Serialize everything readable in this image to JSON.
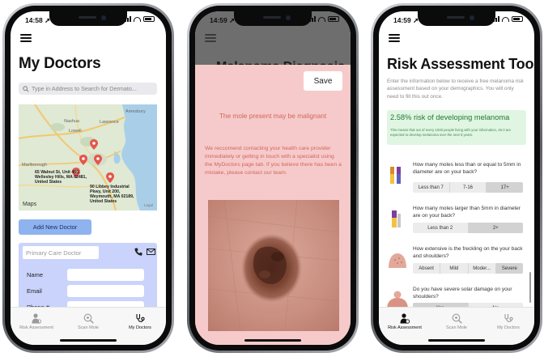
{
  "phone1": {
    "status": {
      "time": "14:58 ➚"
    },
    "title": "My Doctors",
    "search": {
      "placeholder": "Type in Address to Search for Dermato..."
    },
    "map": {
      "places": [
        "Nashua",
        "Lowell",
        "Lawrence",
        "Amesbury",
        "Marlborough"
      ],
      "addresses": [
        "65 Walnut St, Unit 480, Wellesley Hills, MA 02481, United States",
        "90 Libbey Industrial Pkwy, Unit 200, Weymouth, MA 02189, United States"
      ],
      "logo": "Maps",
      "legal": "Legal"
    },
    "add_button": "Add New Doctor",
    "card": {
      "name_placeholder": "Primary Care Doctor",
      "fields": [
        {
          "label": "Name",
          "value": ""
        },
        {
          "label": "Email",
          "value": ""
        },
        {
          "label": "Phone #",
          "value": ""
        }
      ]
    }
  },
  "phone2": {
    "status": {
      "time": "14:59 ➚"
    },
    "title": "Melanoma Diagnosis",
    "save_button": "Save",
    "diagnosis": "The mole present may be malignant",
    "advice": "We reccomend contacting your health care provider immediately or getting in touch with a specialist using the MyDoctors page tab. If you believe there has been a mistake, please contact our team."
  },
  "phone3": {
    "status": {
      "time": "14:59 ➚"
    },
    "title": "Risk Assessment Tool",
    "intro": "Enter the information below to receive a free melanoma risk assessment based on your demographics. You will only need to fill this out once.",
    "result": {
      "title": "2.58% risk of developing melanoma",
      "detail": "This means that out of every 1000 people living with your information, 26.0 are expected to develop melanoma over the next 5 years."
    },
    "questions": [
      {
        "text": "How many moles less than or equal to 5mm in diameter are on your back?",
        "options": [
          "Less than 7",
          "7-16",
          "17+"
        ],
        "selected": 2
      },
      {
        "text": "How many moles larger than 5mm in diameter are on your back?",
        "options": [
          "Less than 2",
          "2+"
        ],
        "selected": 1
      },
      {
        "text": "How extensive is the freckling on the your back and shoulders?",
        "options": [
          "Absent",
          "Mild",
          "Moder...",
          "Severe"
        ],
        "selected": 3
      },
      {
        "text": "Do you have severe solar damage on your shoulders?",
        "options": [
          "Yes",
          "No"
        ],
        "selected": 0
      }
    ]
  },
  "tabs": [
    "Risk Assessment",
    "Scan Mole",
    "My Doctors"
  ],
  "colors": {
    "accent_blue": "#8fb3ee",
    "card_blue": "#c9d3fb",
    "modal_pink": "#f6caca",
    "warning_text": "#d1675c",
    "success_green": "#1f7a32"
  }
}
